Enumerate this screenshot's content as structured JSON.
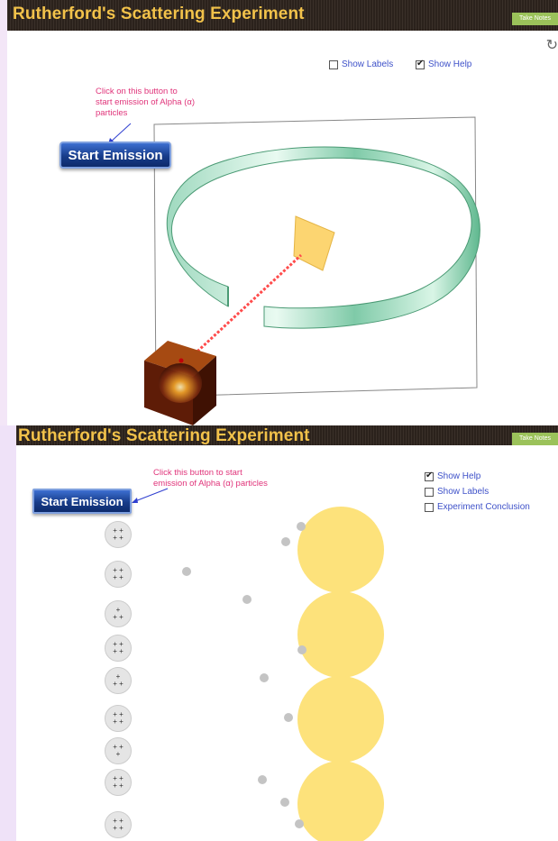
{
  "panel1": {
    "title": "Rutherford's Scattering Experiment",
    "take_notes": "Take Notes",
    "show_labels": {
      "label": "Show Labels",
      "checked": false
    },
    "show_help": {
      "label": "Show Help",
      "checked": true
    },
    "hint_lines": [
      "Click on this button to",
      "start emission of Alpha (α)",
      "particles"
    ],
    "start_button": "Start Emission"
  },
  "panel2": {
    "title": "Rutherford's Scattering Experiment",
    "take_notes": "Take Notes",
    "hint_lines": [
      "Click this button to start",
      "emission of Alpha (α) particles"
    ],
    "start_button": "Start Emission",
    "checkboxes": [
      {
        "label": "Show Help",
        "checked": true
      },
      {
        "label": "Show Labels",
        "checked": false
      },
      {
        "label": "Experiment Conclusion",
        "checked": false
      }
    ]
  },
  "colors": {
    "title": "#f2c24a",
    "hint": "#e0347a",
    "link": "#3f52c9",
    "nucleus": "#fde27b",
    "take_notes": "#9bc25a"
  }
}
